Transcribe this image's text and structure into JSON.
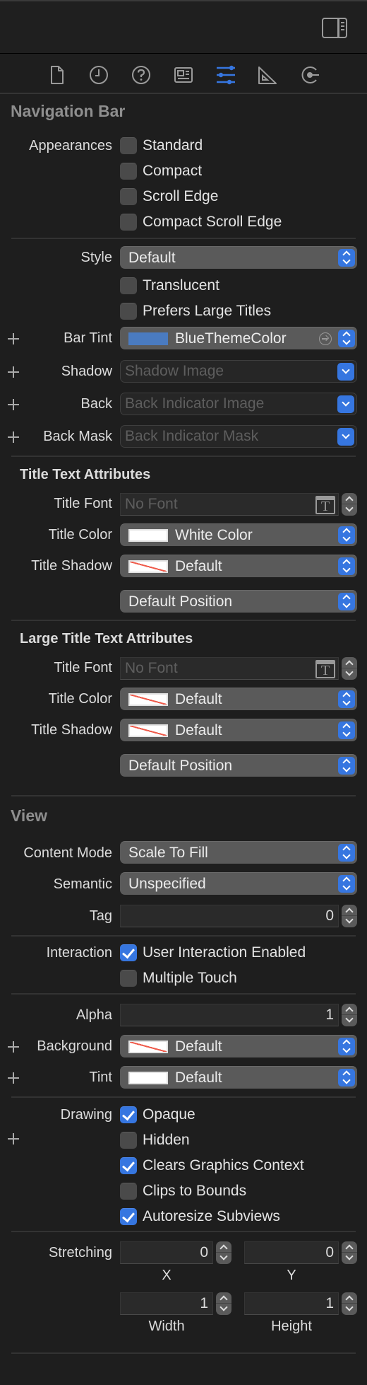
{
  "toolbar": {
    "panel_toggle_icon": "inspector-panel-icon",
    "tabs": [
      {
        "name": "file-inspector",
        "icon": "document-icon",
        "active": false
      },
      {
        "name": "history-inspector",
        "icon": "clock-icon",
        "active": false
      },
      {
        "name": "quick-help",
        "icon": "help-icon",
        "active": false
      },
      {
        "name": "identity-inspector",
        "icon": "identity-card-icon",
        "active": false
      },
      {
        "name": "attributes-inspector",
        "icon": "sliders-icon",
        "active": true
      },
      {
        "name": "size-inspector",
        "icon": "ruler-icon",
        "active": false
      },
      {
        "name": "connections-inspector",
        "icon": "connection-icon",
        "active": false
      }
    ],
    "accent_color": "#3676e0"
  },
  "navigation_bar": {
    "title": "Navigation Bar",
    "appearances_label": "Appearances",
    "appearances": [
      {
        "label": "Standard",
        "checked": false
      },
      {
        "label": "Compact",
        "checked": false
      },
      {
        "label": "Scroll Edge",
        "checked": false
      },
      {
        "label": "Compact Scroll Edge",
        "checked": false
      }
    ],
    "style_label": "Style",
    "style_value": "Default",
    "translucent": {
      "label": "Translucent",
      "checked": false
    },
    "prefers_large_titles": {
      "label": "Prefers Large Titles",
      "checked": false
    },
    "bar_tint_label": "Bar Tint",
    "bar_tint_value": "BlueThemeColor",
    "bar_tint_color": "#4a7bc0",
    "shadow_label": "Shadow",
    "shadow_placeholder": "Shadow Image",
    "back_label": "Back",
    "back_placeholder": "Back Indicator Image",
    "back_mask_label": "Back Mask",
    "back_mask_placeholder": "Back Indicator Mask"
  },
  "title_text_attributes": {
    "title": "Title Text Attributes",
    "font_label": "Title Font",
    "font_placeholder": "No Font",
    "color_label": "Title Color",
    "color_value": "White Color",
    "shadow_label": "Title Shadow",
    "shadow_value": "Default",
    "position_value": "Default Position"
  },
  "large_title_text_attributes": {
    "title": "Large Title Text Attributes",
    "font_label": "Title Font",
    "font_placeholder": "No Font",
    "color_label": "Title Color",
    "color_value": "Default",
    "shadow_label": "Title Shadow",
    "shadow_value": "Default",
    "position_value": "Default Position"
  },
  "view": {
    "title": "View",
    "content_mode_label": "Content Mode",
    "content_mode_value": "Scale To Fill",
    "semantic_label": "Semantic",
    "semantic_value": "Unspecified",
    "tag_label": "Tag",
    "tag_value": "0",
    "interaction_label": "Interaction",
    "user_interaction": {
      "label": "User Interaction Enabled",
      "checked": true
    },
    "multiple_touch": {
      "label": "Multiple Touch",
      "checked": false
    },
    "alpha_label": "Alpha",
    "alpha_value": "1",
    "background_label": "Background",
    "background_value": "Default",
    "tint_label": "Tint",
    "tint_value": "Default",
    "drawing_label": "Drawing",
    "drawing": [
      {
        "label": "Opaque",
        "checked": true
      },
      {
        "label": "Hidden",
        "checked": false
      },
      {
        "label": "Clears Graphics Context",
        "checked": true
      },
      {
        "label": "Clips to Bounds",
        "checked": false
      },
      {
        "label": "Autoresize Subviews",
        "checked": true
      }
    ],
    "stretching_label": "Stretching",
    "stretching": {
      "x_label": "X",
      "x_value": "0",
      "y_label": "Y",
      "y_value": "0",
      "width_label": "Width",
      "width_value": "1",
      "height_label": "Height",
      "height_value": "1"
    }
  }
}
